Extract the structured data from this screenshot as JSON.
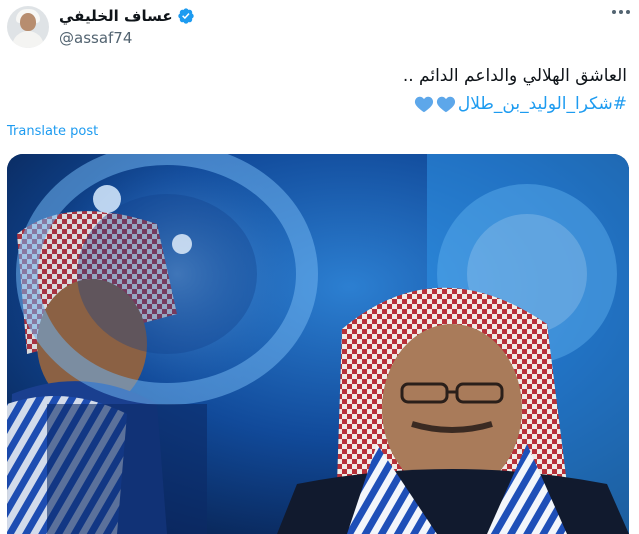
{
  "tweet": {
    "display_name": "عساف الخليفي",
    "handle": "@assaf74",
    "text_line1": "العاشق الهلالي والداعم الدائم ..",
    "hashtag": "#شكرا_الوليد_بن_طلال",
    "translate_label": "Translate post"
  },
  "icons": {
    "verified": "verified-badge-icon",
    "more": "more-options-icon",
    "heart": "blue-heart-icon"
  },
  "colors": {
    "link": "#1d9bf0",
    "text": "#0f1419",
    "muted": "#536471"
  }
}
